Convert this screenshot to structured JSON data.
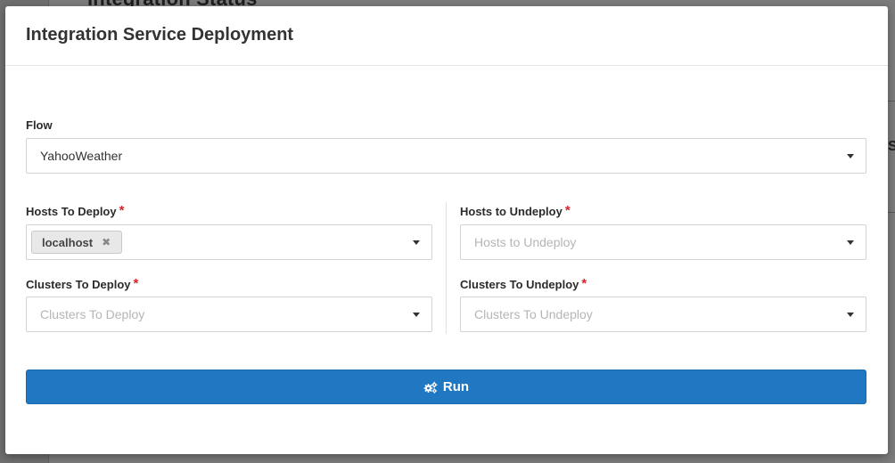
{
  "background": {
    "heading": "Integration Status",
    "right_fragment": "S"
  },
  "modal": {
    "title": "Integration Service Deployment",
    "flow": {
      "label": "Flow",
      "value": "YahooWeather"
    },
    "hosts_to_deploy": {
      "label": "Hosts To Deploy",
      "required_mark": "*",
      "selected": [
        {
          "label": "localhost",
          "remove_glyph": "✖"
        }
      ]
    },
    "hosts_to_undeploy": {
      "label": "Hosts to Undeploy",
      "required_mark": "*",
      "placeholder": "Hosts to Undeploy"
    },
    "clusters_to_deploy": {
      "label": "Clusters To Deploy",
      "required_mark": "*",
      "placeholder": "Clusters To Deploy"
    },
    "clusters_to_undeploy": {
      "label": "Clusters To Undeploy",
      "required_mark": "*",
      "placeholder": "Clusters To Undeploy"
    },
    "run_button": {
      "label": "Run",
      "icon": "cogs-icon"
    }
  },
  "colors": {
    "primary": "#1f78c1",
    "required": "#d9232d",
    "overlay": "#7c7c7c"
  }
}
